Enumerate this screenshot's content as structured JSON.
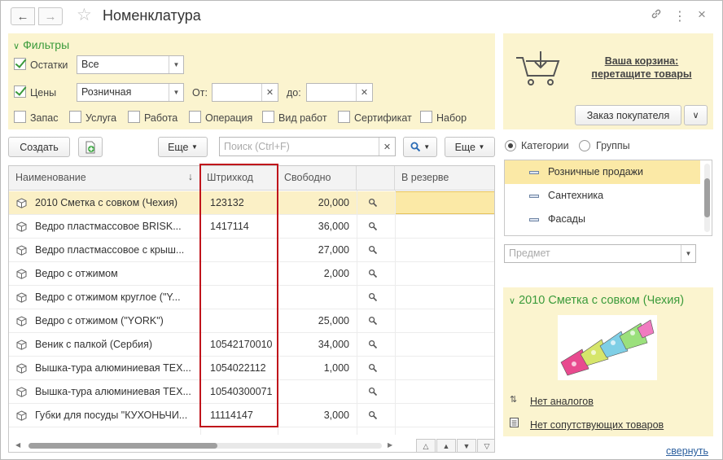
{
  "window": {
    "title": "Номенклатура"
  },
  "filters": {
    "header": "Фильтры",
    "ostatki": {
      "label": "Остатки",
      "checked": true,
      "value": "Все"
    },
    "tseny": {
      "label": "Цены",
      "checked": true,
      "value": "Розничная"
    },
    "from_label": "От:",
    "to_label": "до:",
    "types": [
      "Запас",
      "Услуга",
      "Работа",
      "Операция",
      "Вид работ",
      "Сертификат",
      "Набор"
    ]
  },
  "toolbar": {
    "create_label": "Создать",
    "more1_label": "Еще",
    "search_placeholder": "Поиск (Ctrl+F)",
    "more2_label": "Еще"
  },
  "table": {
    "columns": [
      "Наименование",
      "Штрихкод",
      "Свободно",
      "",
      "В резерве"
    ],
    "rows": [
      {
        "name": "2010 Сметка с совком (Чехия)",
        "barcode": "123132",
        "free": "20,000"
      },
      {
        "name": "Ведро пластмассовое BRISK...",
        "barcode": "1417114",
        "free": "36,000"
      },
      {
        "name": "Ведро пластмассовое с крыш...",
        "barcode": "",
        "free": "27,000"
      },
      {
        "name": "Ведро с отжимом",
        "barcode": "",
        "free": "2,000"
      },
      {
        "name": "Ведро с отжимом круглое (\"Y...",
        "barcode": "",
        "free": ""
      },
      {
        "name": "Ведро с отжимом (\"YORK\")",
        "barcode": "",
        "free": "25,000"
      },
      {
        "name": "Веник с палкой (Сербия)",
        "barcode": "10542170010",
        "free": "34,000"
      },
      {
        "name": "Вышка-тура алюминиевая ТЕХ...",
        "barcode": "1054022112",
        "free": "1,000"
      },
      {
        "name": "Вышка-тура алюминиевая ТЕХ...",
        "barcode": "10540300071",
        "free": ""
      },
      {
        "name": "Губки для посуды \"КУХОНЬЧИ...",
        "barcode": "11114147",
        "free": "3,000"
      }
    ]
  },
  "cart": {
    "line1": "Ваша корзина:",
    "line2": "перетащите товары",
    "order_label": "Заказ покупателя"
  },
  "grouping": {
    "option1": "Категории",
    "option2": "Группы"
  },
  "categories": [
    "Розничные продажи",
    "Сантехника",
    "Фасады"
  ],
  "subject_placeholder": "Предмет",
  "detail": {
    "title": "2010 Сметка с совком (Чехия)",
    "analogs_link": "Нет аналогов",
    "related_link": "Нет сопутствующих товаров"
  },
  "collapse_link": "свернуть",
  "colors": {
    "accent_green": "#3b9b3b",
    "highlight": "#fbf4cf",
    "selection": "#fbe9a6",
    "red_frame": "#c0141b"
  }
}
